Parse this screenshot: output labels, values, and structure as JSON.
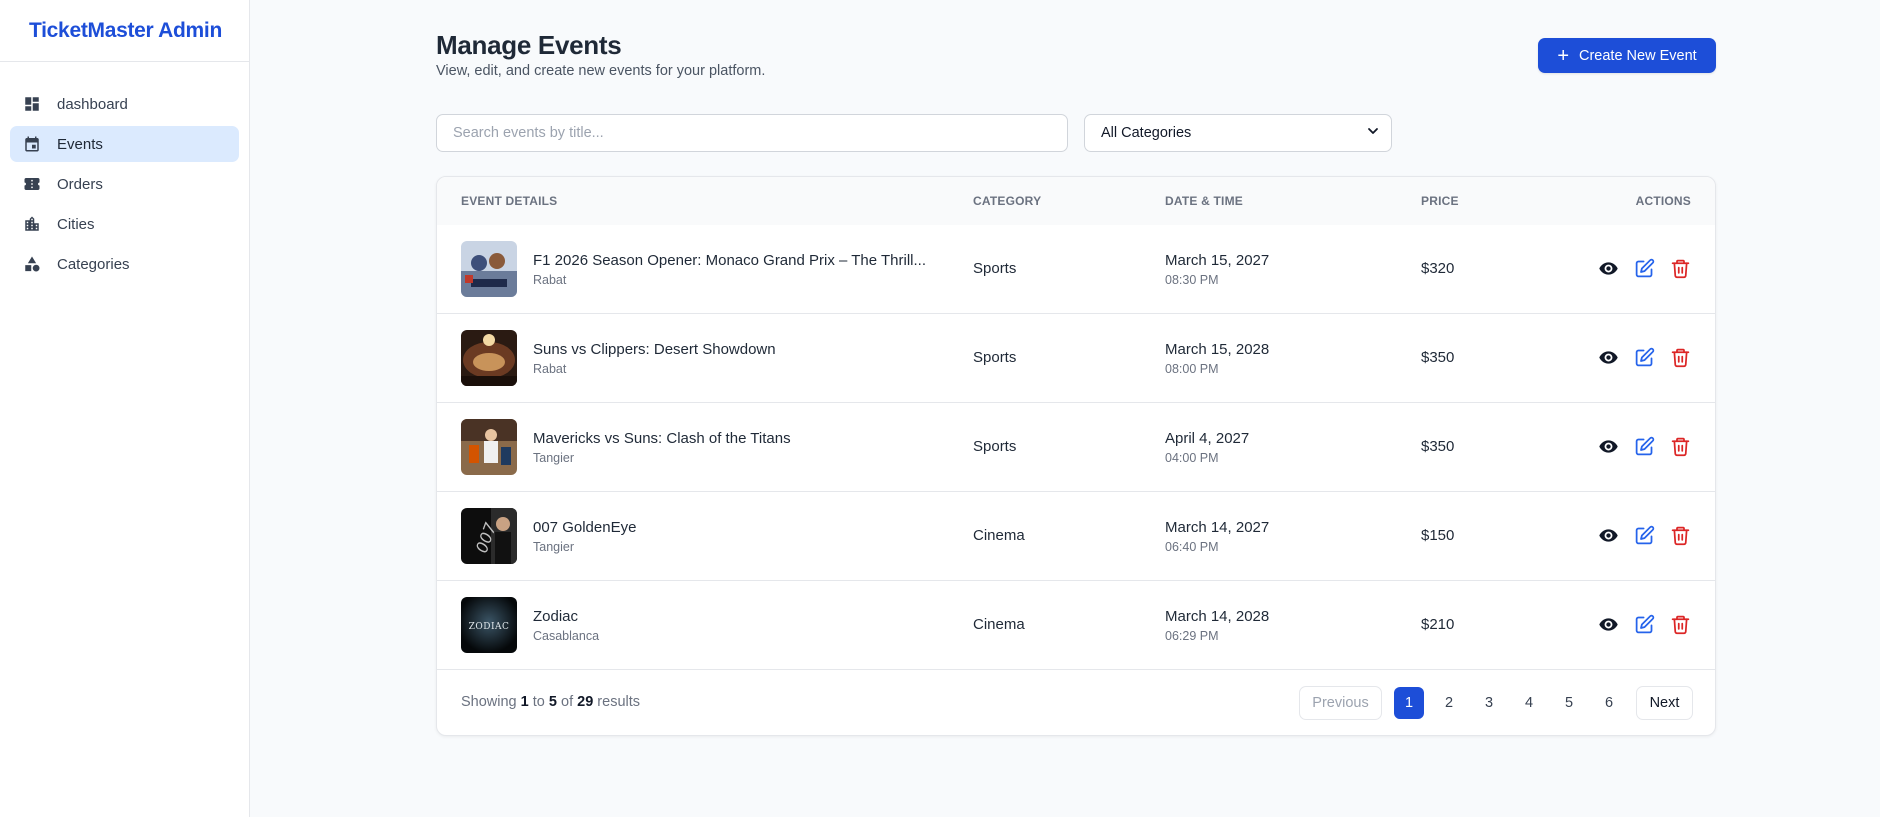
{
  "app": {
    "brand": "TicketMaster Admin"
  },
  "sidebar": {
    "items": [
      {
        "label": "dashboard",
        "icon": "dashboard-icon",
        "active": false
      },
      {
        "label": "Events",
        "icon": "calendar-icon",
        "active": true
      },
      {
        "label": "Orders",
        "icon": "ticket-icon",
        "active": false
      },
      {
        "label": "Cities",
        "icon": "city-icon",
        "active": false
      },
      {
        "label": "Categories",
        "icon": "shapes-icon",
        "active": false
      }
    ]
  },
  "header": {
    "title": "Manage Events",
    "subtitle": "View, edit, and create new events for your platform.",
    "create_button": "Create New Event"
  },
  "filters": {
    "search_placeholder": "Search events by title...",
    "category_selected": "All Categories"
  },
  "table": {
    "columns": {
      "details": "EVENT DETAILS",
      "category": "CATEGORY",
      "date": "DATE & TIME",
      "price": "PRICE",
      "actions": "ACTIONS"
    },
    "rows": [
      {
        "title": "F1 2026 Season Opener: Monaco Grand Prix – The Thrill...",
        "city": "Rabat",
        "category": "Sports",
        "date": "March 15, 2027",
        "time": "08:30 PM",
        "price": "$320"
      },
      {
        "title": "Suns vs Clippers: Desert Showdown",
        "city": "Rabat",
        "category": "Sports",
        "date": "March 15, 2028",
        "time": "08:00 PM",
        "price": "$350"
      },
      {
        "title": "Mavericks vs Suns: Clash of the Titans",
        "city": "Tangier",
        "category": "Sports",
        "date": "April 4, 2027",
        "time": "04:00 PM",
        "price": "$350"
      },
      {
        "title": "007 GoldenEye",
        "city": "Tangier",
        "category": "Cinema",
        "date": "March 14, 2027",
        "time": "06:40 PM",
        "price": "$150"
      },
      {
        "title": "Zodiac",
        "city": "Casablanca",
        "category": "Cinema",
        "date": "March 14, 2028",
        "time": "06:29 PM",
        "price": "$210"
      }
    ]
  },
  "pagination": {
    "showing_prefix": "Showing",
    "from": "1",
    "to_word": "to",
    "to": "5",
    "of_word": "of",
    "total": "29",
    "suffix": "results",
    "previous": "Previous",
    "next": "Next",
    "pages": [
      "1",
      "2",
      "3",
      "4",
      "5",
      "6"
    ],
    "current": "1"
  },
  "colors": {
    "accent": "#1d4ed8",
    "active_nav_bg": "#dbeafe",
    "view_icon": "#111827",
    "edit_icon": "#2563eb",
    "delete_icon": "#dc2626"
  }
}
